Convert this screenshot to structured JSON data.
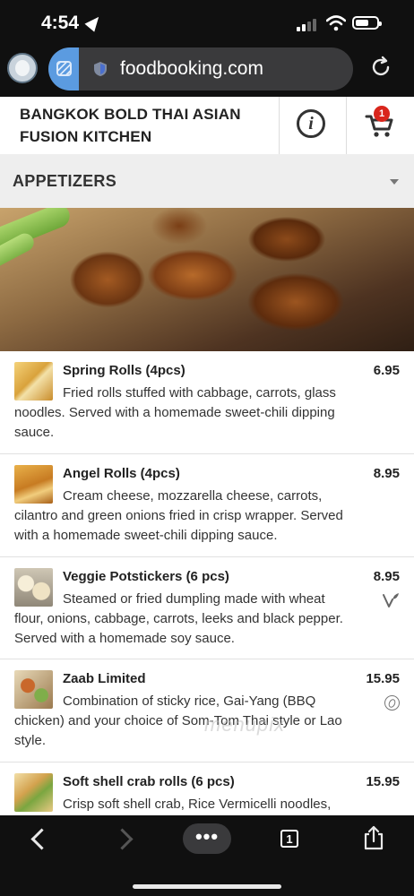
{
  "status_bar": {
    "time": "4:54"
  },
  "browser": {
    "url": "foodbooking.com"
  },
  "restaurant": {
    "name": "BANGKOK BOLD THAI ASIAN FUSION KITCHEN",
    "cart_count": "1"
  },
  "category": {
    "title": "APPETIZERS"
  },
  "menu_items": [
    {
      "name": "Spring Rolls (4pcs)",
      "price": "6.95",
      "description": "Fried rolls stuffed with cabbage, carrots, glass noodles. Served with a homemade sweet-chili dipping sauce.",
      "tag": ""
    },
    {
      "name": "Angel Rolls (4pcs)",
      "price": "8.95",
      "description": "Cream cheese, mozzarella cheese, carrots, cilantro and green onions fried in crisp wrapper. Served with a homemade sweet-chili dipping sauce.",
      "tag": ""
    },
    {
      "name": "Veggie Potstickers (6 pcs)",
      "price": "8.95",
      "description": "Steamed or fried dumpling made with wheat flour, onions, cabbage, carrots, leeks and black pepper. Served with a homemade soy sauce.",
      "tag": "vegetarian-icon"
    },
    {
      "name": "Zaab Limited",
      "price": "15.95",
      "description": "Combination of sticky rice, Gai-Yang (BBQ chicken) and your choice of Som-Tom Thai style or Lao style.",
      "tag": "spicy-icon"
    },
    {
      "name": "Soft shell crab rolls (6 pcs)",
      "price": "15.95",
      "description": "Crisp soft shell crab, Rice Vermicelli noodles,",
      "tag": ""
    }
  ],
  "watermark": "menupix",
  "bottom_bar": {
    "more_label": "•••",
    "tabs_count": "1"
  },
  "colors": {
    "cart_badge": "#d9261c",
    "category_bg": "#eeeeee",
    "browser_chrome": "#101010",
    "tab_icon": "#5b9be0"
  }
}
